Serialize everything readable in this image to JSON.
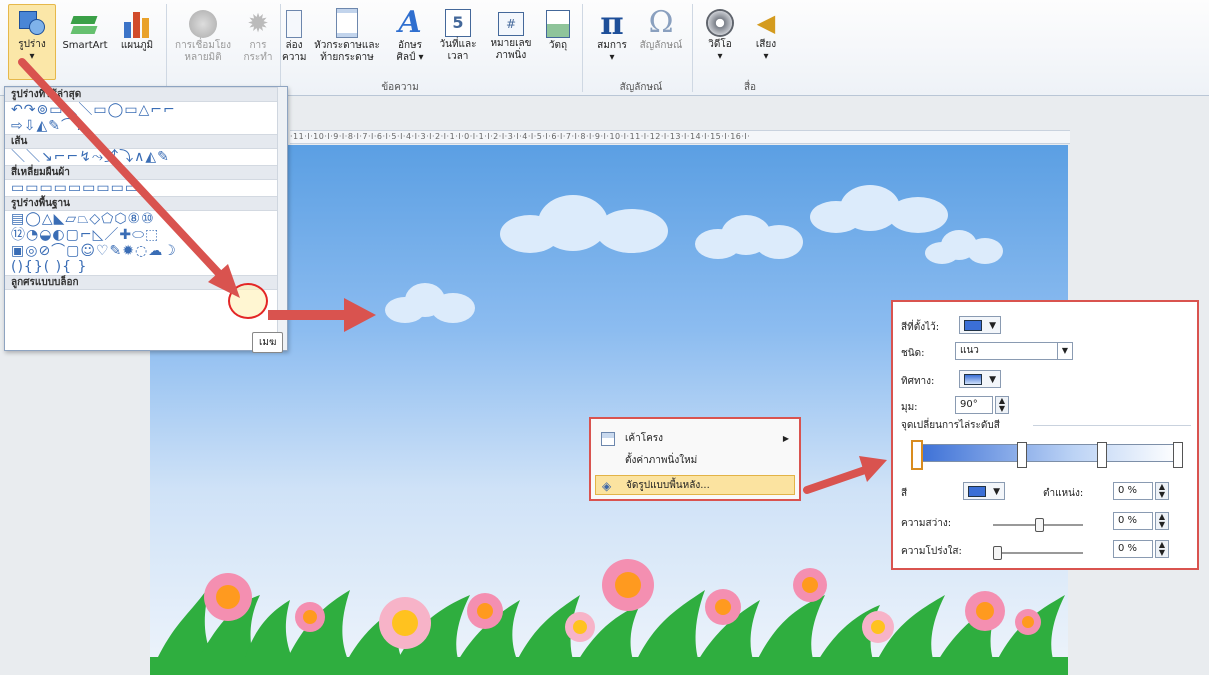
{
  "ribbon": {
    "buttons": [
      {
        "label": "รูปร่าง",
        "sub": "▾"
      },
      {
        "label": "SmartArt"
      },
      {
        "label": "แผนภูมิ"
      },
      {
        "label": "การเชื่อมโยง",
        "sub": "หลายมิติ"
      },
      {
        "label": "การ",
        "sub": "กระทำ"
      },
      {
        "label": "ล่อง",
        "sub": "ความ"
      },
      {
        "label": "หัวกระดาษและ",
        "sub": "ท้ายกระดาษ"
      },
      {
        "label": "อักษร",
        "sub": "ศิลป์ ▾"
      },
      {
        "label": "วันที่และ",
        "sub": "เวลา"
      },
      {
        "label": "หมายเลข",
        "sub": "ภาพนิ่ง"
      },
      {
        "label": "วัตถุ"
      },
      {
        "label": "สมการ",
        "sub": "▾"
      },
      {
        "label": "สัญลักษณ์"
      },
      {
        "label": "วิดีโอ",
        "sub": "▾"
      },
      {
        "label": "เสียง",
        "sub": "▾"
      }
    ],
    "groups": [
      "ข้อความ",
      "สัญลักษณ์",
      "สื่อ"
    ]
  },
  "ruler": "·11·I·10·I·9·I·8·I·7·I·6·I·5·I·4·I·3·I·2·I·1·I·0·I·1·I·2·I·3·I·4·I·5·I·6·I·7·I·8·I·9·I·10·I·11·I·12·I·13·I·14·I·15·I·16·I·",
  "gallery": {
    "sections": [
      {
        "title": "รูปร่างที่ใช้ล่าสุด",
        "rows": [
          "↶↷⊚▭＼＼▭◯▭△⌐⌐",
          "⇨⇩◭✎⌒∧"
        ]
      },
      {
        "title": "เส้น",
        "rows": [
          "＼＼↘⌐⌐↯⤳⤴⤵∧◭✎"
        ]
      },
      {
        "title": "สี่เหลี่ยมผืนผ้า",
        "rows": [
          "▭▭▭▭▭▭▭▭▭"
        ]
      },
      {
        "title": "รูปร่างพื้นฐาน",
        "rows": [
          "▤◯△◣▱⏢◇⬠⬡⑧⑩",
          "⑫◔◒◐▢⌐◺／✚⬭⬚",
          "▣◎⊘⌒▢☺♡✎✹◌☁☽",
          "(){}( ){ }"
        ]
      },
      {
        "title": "ลูกศรแบบบล็อก",
        "rows": []
      }
    ],
    "tooltip": "เมฆ"
  },
  "context_menu": {
    "items": [
      {
        "label": "เค้าโครง",
        "has_submenu": true
      },
      {
        "label": "ตั้งค่าภาพนิ่งใหม่",
        "has_submenu": false
      },
      {
        "label": "จัดรูปแบบพื้นหลัง...",
        "has_submenu": false,
        "highlighted": true
      }
    ]
  },
  "fill_panel": {
    "preset_label": "สีที่ตั้งไว้:",
    "type_label": "ชนิด:",
    "type_value": "แนว",
    "direction_label": "ทิศทาง:",
    "angle_label": "มุม:",
    "angle_value": "90°",
    "stops_label": "จุดเปลี่ยนการไล่ระดับสี",
    "color_label": "สี",
    "position_label": "ตำแหน่ง:",
    "position_value": "0 %",
    "brightness_label": "ความสว่าง:",
    "brightness_value": "0 %",
    "transparency_label": "ความโปร่งใส:",
    "transparency_value": "0 %"
  },
  "colors": {
    "accent_red": "#d9534f",
    "sky_top": "#5b9fe3",
    "sky_bottom": "#eef4fb",
    "grass": "#2fae3f",
    "cloud": "#dcebfb"
  }
}
